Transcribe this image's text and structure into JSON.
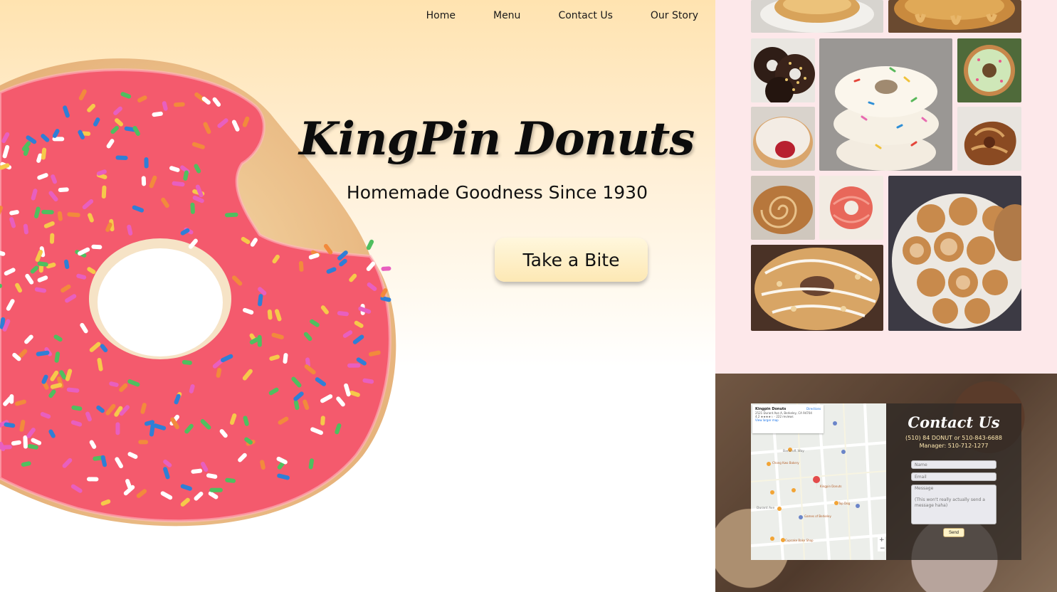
{
  "nav": {
    "items": [
      {
        "label": "Home"
      },
      {
        "label": "Menu"
      },
      {
        "label": "Contact Us"
      },
      {
        "label": "Our Story"
      }
    ]
  },
  "hero": {
    "title": "KingPin Donuts",
    "subtitle": "Homemade Goodness Since 1930",
    "cta_label": "Take a Bite"
  },
  "gallery": {
    "photos": [
      "glazed-donut-plate-photo",
      "caramel-glazed-donut-photo",
      "chocolate-sprinkle-donuts-photo",
      "rainbow-sprinkle-donut-stack-photo",
      "green-frosted-donut-photo",
      "jelly-filled-donut-photo",
      "apple-fritter-photo",
      "cinnamon-roll-photo",
      "red-cruller-photo",
      "crumb-topped-donut-photo",
      "sugar-donut-holes-photo"
    ]
  },
  "contact": {
    "title": "Contact Us",
    "phone_line": "(510) 84 DONUT or 510-843-6688",
    "manager_line": "Manager: 510-712-1277",
    "name_placeholder": "Name",
    "email_placeholder": "Email",
    "message_placeholder": "Message\n\n(This won't really actually send a message haha)",
    "send_label": "Send"
  },
  "map": {
    "place_name": "Kingpin Donuts",
    "address": "2521 Durant Ave A, Berkeley, CA 94704",
    "rating": "4.2 ★★★★☆ · 222 reviews",
    "directions_label": "Directions",
    "view_larger_label": "View larger map",
    "labels": [
      "Bancroft Way",
      "Durant Ave",
      "Chong Kwo Bakery",
      "Kingpin Donuts",
      "Games of Berkeley",
      "Cupcake Bake Shop",
      "Top Dog"
    ]
  },
  "colors": {
    "hero_top": "#ffe3b0",
    "gallery_bg": "#fde8ea",
    "cta_bg": "#fde8b4",
    "contact_accent": "#ffe9b0"
  }
}
